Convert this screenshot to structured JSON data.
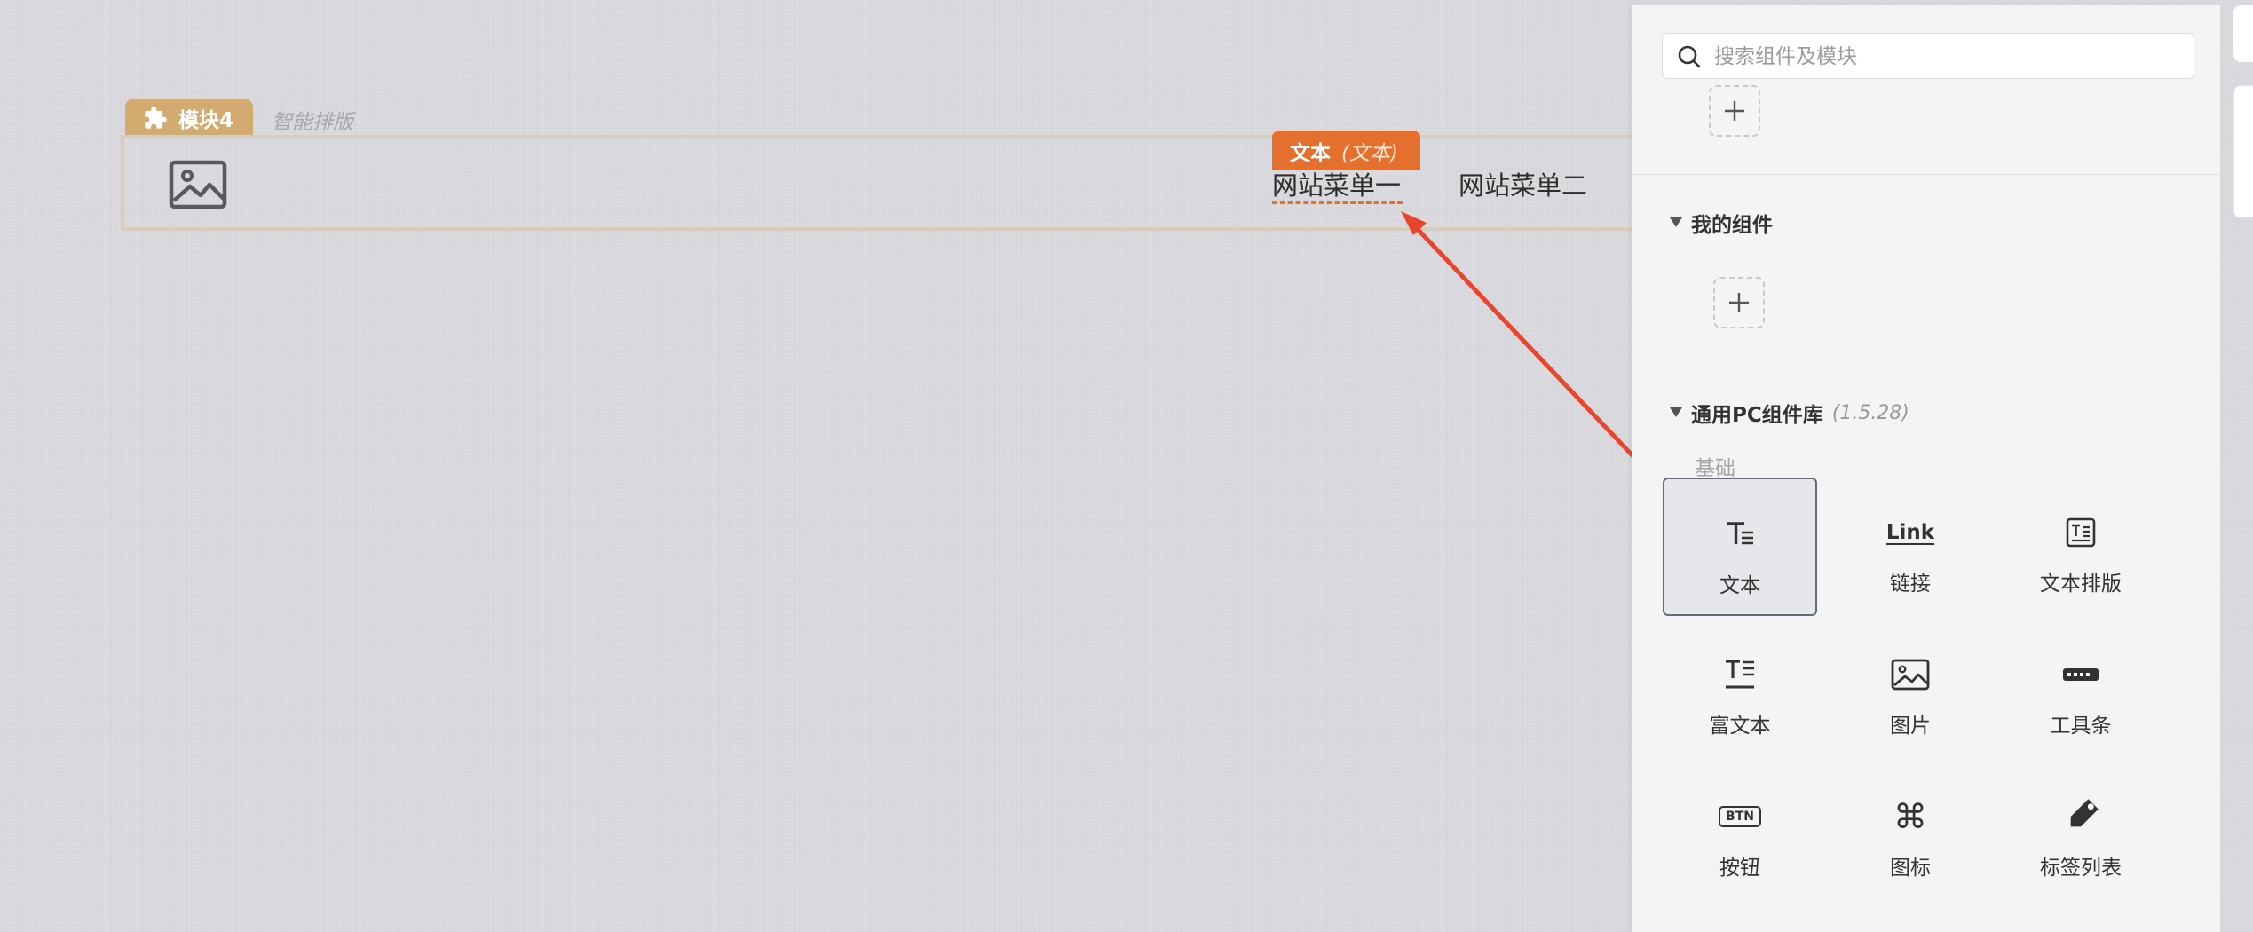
{
  "module": {
    "tag_label": "模块4",
    "layout_mode": "智能排版"
  },
  "header_menu": {
    "item1": "网站菜单一",
    "item2": "网站菜单二"
  },
  "selected_component_tag": {
    "name": "文本",
    "type": "(文本)"
  },
  "panel": {
    "search_placeholder": "搜索组件及模块",
    "my_components_title": "我的组件",
    "library_title": "通用PC组件库",
    "library_version": "(1.5.28)",
    "basic_section": "基础",
    "components": [
      {
        "label": "文本",
        "icon": "text-icon",
        "selected": true
      },
      {
        "label": "链接",
        "icon": "link-icon",
        "icon_text": "Link",
        "selected": false
      },
      {
        "label": "文本排版",
        "icon": "text-layout-icon",
        "selected": false
      },
      {
        "label": "富文本",
        "icon": "rich-text-icon",
        "selected": false
      },
      {
        "label": "图片",
        "icon": "image-icon",
        "selected": false
      },
      {
        "label": "工具条",
        "icon": "toolbar-icon",
        "selected": false
      },
      {
        "label": "按钮",
        "icon": "button-icon",
        "icon_text": "BTN",
        "selected": false
      },
      {
        "label": "图标",
        "icon": "command-icon",
        "selected": false
      },
      {
        "label": "标签列表",
        "icon": "tag-icon",
        "selected": false
      }
    ]
  },
  "colors": {
    "module_tag": "#d3ab71",
    "text_tag": "#e5702e",
    "arrow": "#e8452c",
    "selected_border": "#646b7c"
  }
}
